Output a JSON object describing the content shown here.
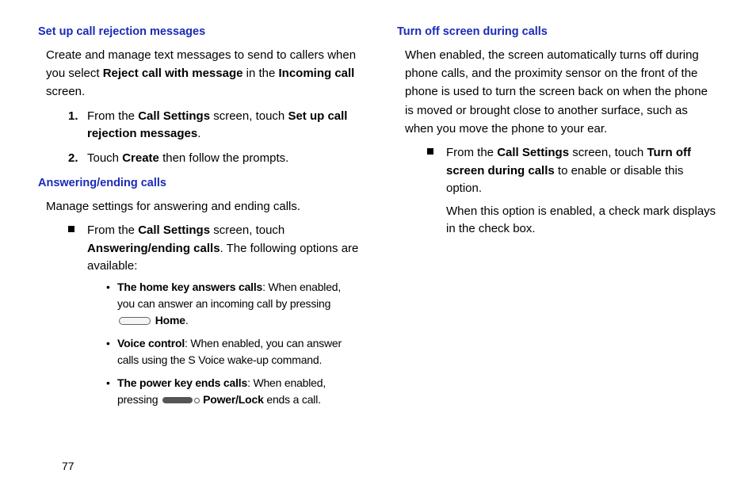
{
  "page_number": "77",
  "left": {
    "section1": {
      "heading": "Set up call rejection messages",
      "intro_pre": "Create and manage text messages to send to callers when you select ",
      "intro_b1": "Reject call with message",
      "intro_mid": " in the ",
      "intro_b2": "Incoming call",
      "intro_post": " screen.",
      "step1_pre": "From the ",
      "step1_b1": "Call Settings",
      "step1_mid": " screen, touch ",
      "step1_b2": "Set up call rejection messages",
      "step1_post": ".",
      "step2_pre": "Touch ",
      "step2_b1": "Create",
      "step2_post": " then follow the prompts."
    },
    "section2": {
      "heading": "Answering/ending calls",
      "intro": "Manage settings for answering and ending calls.",
      "item_pre": "From the ",
      "item_b1": "Call Settings",
      "item_mid": " screen, touch ",
      "item_b2": "Answering/ending calls",
      "item_post": ". The following options are available:",
      "b1_label": "The home key answers calls",
      "b1_text_a": ": When enabled, you can answer an incoming call by pressing ",
      "b1_text_b": " ",
      "b1_bold2": "Home",
      "b1_text_c": ".",
      "b2_label": "Voice control",
      "b2_text": ": When enabled, you can answer calls using the S Voice wake-up command.",
      "b3_label": "The power key ends calls",
      "b3_text_a": ": When enabled, pressing ",
      "b3_bold2": "Power/Lock",
      "b3_text_b": " ends a call."
    }
  },
  "right": {
    "section1": {
      "heading": "Turn off screen during calls",
      "intro": "When enabled, the screen automatically turns off during phone calls, and the proximity sensor on the front of the phone is used to turn the screen back on when the phone is moved or brought close to another surface, such as when you move the phone to your ear.",
      "item_pre": "From the ",
      "item_b1": "Call Settings",
      "item_mid": " screen, touch ",
      "item_b2": "Turn off screen during calls",
      "item_post": " to enable or disable this option.",
      "item_cont": "When this option is enabled, a check mark displays in the check box."
    }
  }
}
